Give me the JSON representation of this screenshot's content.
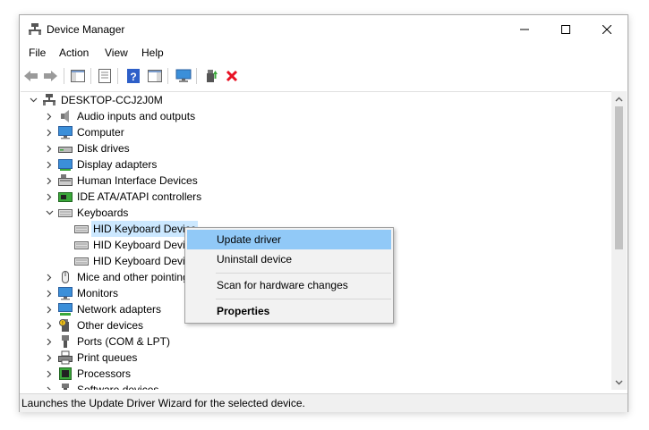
{
  "window": {
    "title": "Device Manager"
  },
  "menu": [
    "File",
    "Action",
    "View",
    "Help"
  ],
  "toolbar": [
    "back-icon",
    "forward-icon",
    "show-hide-console-tree-icon",
    "properties-icon",
    "help-icon",
    "action-pane-icon",
    "monitor-icon",
    "update-driver-icon",
    "uninstall-icon"
  ],
  "tree": {
    "root": "DESKTOP-CCJ2J0M",
    "categories": [
      {
        "label": "Audio inputs and outputs",
        "icon": "speaker-icon"
      },
      {
        "label": "Computer",
        "icon": "computer-icon"
      },
      {
        "label": "Disk drives",
        "icon": "disk-drive-icon"
      },
      {
        "label": "Display adapters",
        "icon": "display-adapter-icon"
      },
      {
        "label": "Human Interface Devices",
        "icon": "hid-icon"
      },
      {
        "label": "IDE ATA/ATAPI controllers",
        "icon": "ide-controller-icon"
      },
      {
        "label": "Keyboards",
        "icon": "keyboard-icon"
      },
      {
        "label": "Mice and other pointing devices",
        "icon": "mouse-icon"
      },
      {
        "label": "Monitors",
        "icon": "monitor-icon"
      },
      {
        "label": "Network adapters",
        "icon": "network-adapter-icon"
      },
      {
        "label": "Other devices",
        "icon": "other-devices-icon"
      },
      {
        "label": "Ports (COM & LPT)",
        "icon": "port-icon"
      },
      {
        "label": "Print queues",
        "icon": "printer-icon"
      },
      {
        "label": "Processors",
        "icon": "processor-icon"
      },
      {
        "label": "Software devices",
        "icon": "software-device-icon"
      }
    ],
    "keyboard_devices": [
      "HID Keyboard Device",
      "HID Keyboard Device",
      "HID Keyboard Device"
    ]
  },
  "context_menu": {
    "update": "Update driver",
    "uninstall": "Uninstall device",
    "scan": "Scan for hardware changes",
    "properties": "Properties"
  },
  "status": "Launches the Update Driver Wizard for the selected device.",
  "colors": {
    "selection": "#cce8ff",
    "menu_highlight": "#91c9f7",
    "uninstall_red": "#e81123"
  }
}
